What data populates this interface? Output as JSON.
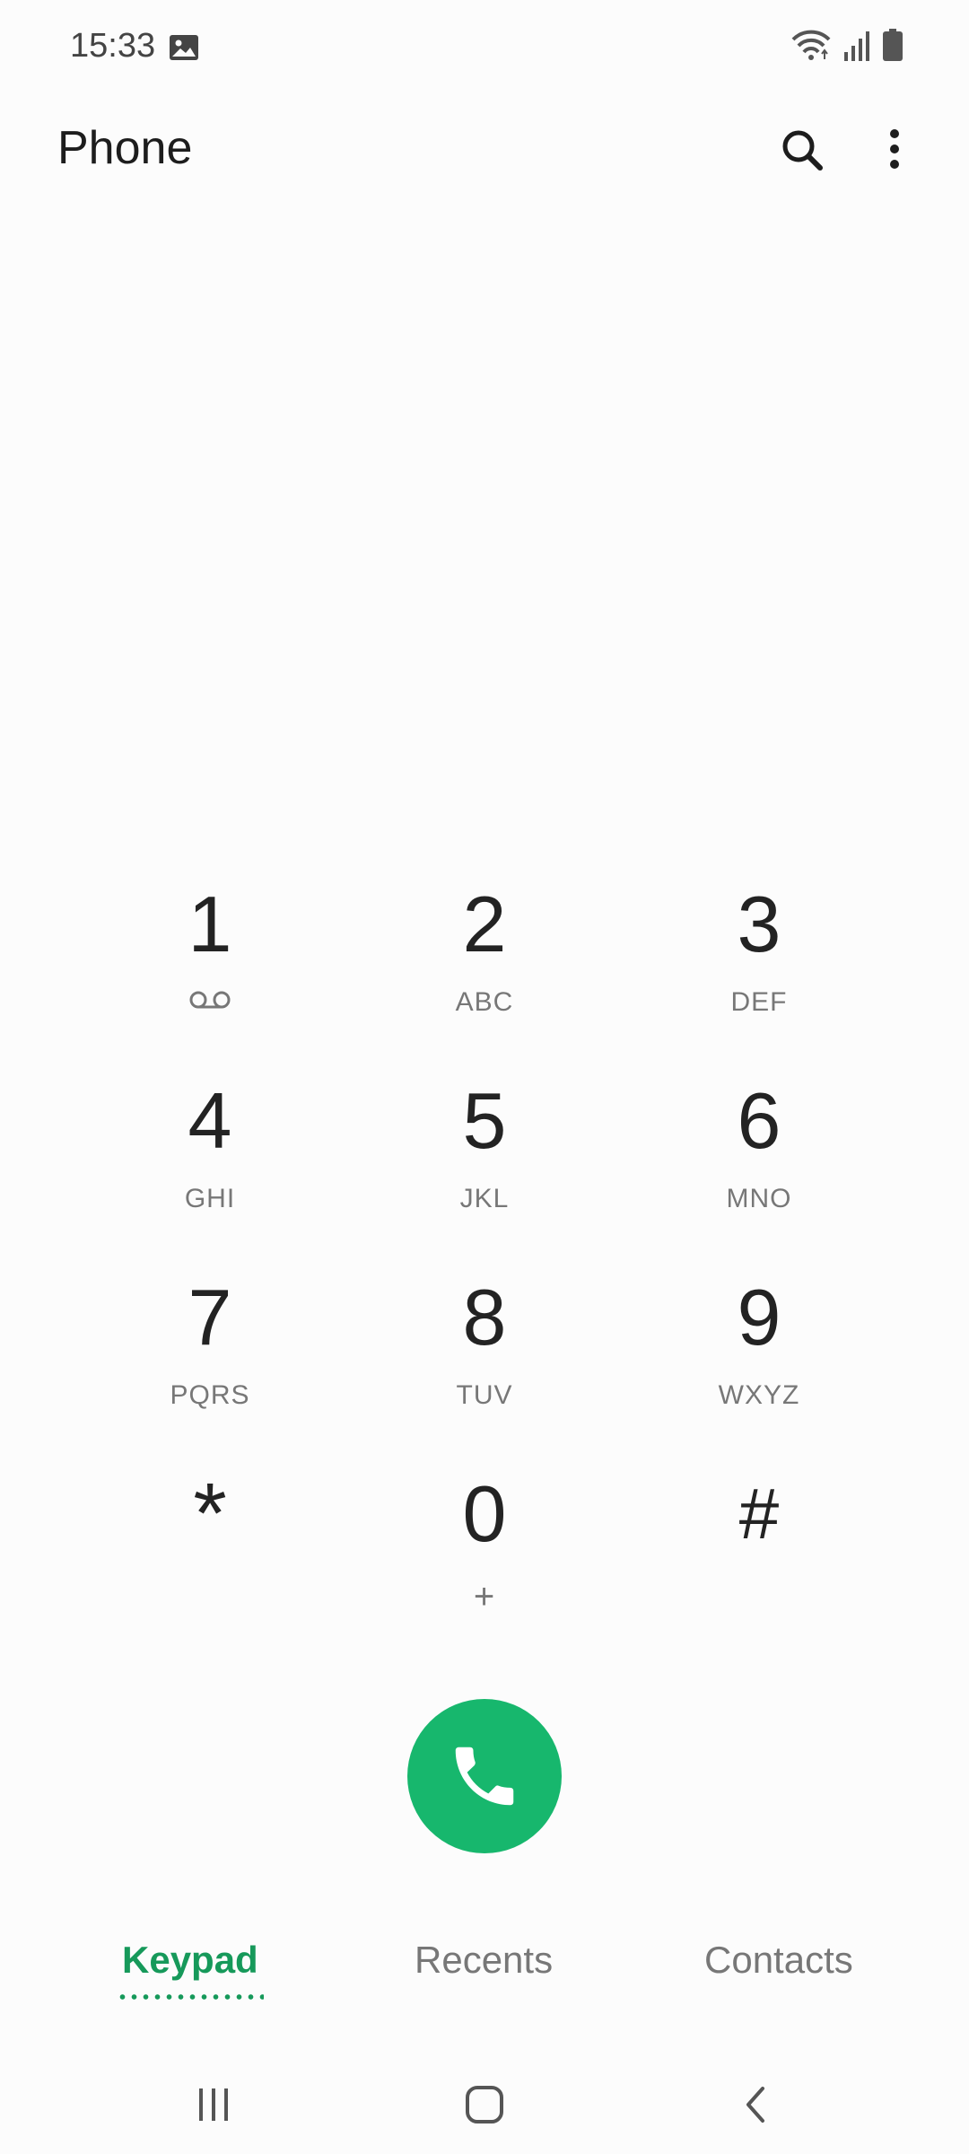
{
  "status_bar": {
    "time": "15:33",
    "icons": [
      "image-notification-icon",
      "wifi-icon",
      "signal-icon",
      "battery-icon"
    ]
  },
  "app_bar": {
    "title": "Phone",
    "actions": [
      "search-icon",
      "more-options-icon"
    ]
  },
  "keypad": {
    "keys": [
      {
        "digit": "1",
        "letters": "",
        "icon": "voicemail-icon"
      },
      {
        "digit": "2",
        "letters": "ABC"
      },
      {
        "digit": "3",
        "letters": "DEF"
      },
      {
        "digit": "4",
        "letters": "GHI"
      },
      {
        "digit": "5",
        "letters": "JKL"
      },
      {
        "digit": "6",
        "letters": "MNO"
      },
      {
        "digit": "7",
        "letters": "PQRS"
      },
      {
        "digit": "8",
        "letters": "TUV"
      },
      {
        "digit": "9",
        "letters": "WXYZ"
      },
      {
        "digit": "*",
        "letters": ""
      },
      {
        "digit": "0",
        "letters": "+"
      },
      {
        "digit": "#",
        "letters": ""
      }
    ]
  },
  "call_button": {
    "icon": "phone-icon",
    "color": "#17b76d"
  },
  "tabs": [
    {
      "label": "Keypad",
      "active": true
    },
    {
      "label": "Recents",
      "active": false
    },
    {
      "label": "Contacts",
      "active": false
    }
  ],
  "colors": {
    "accent": "#16995a",
    "call_green": "#17b76d"
  },
  "navbar": {
    "buttons": [
      "recent-apps-icon",
      "home-icon",
      "back-icon"
    ]
  }
}
